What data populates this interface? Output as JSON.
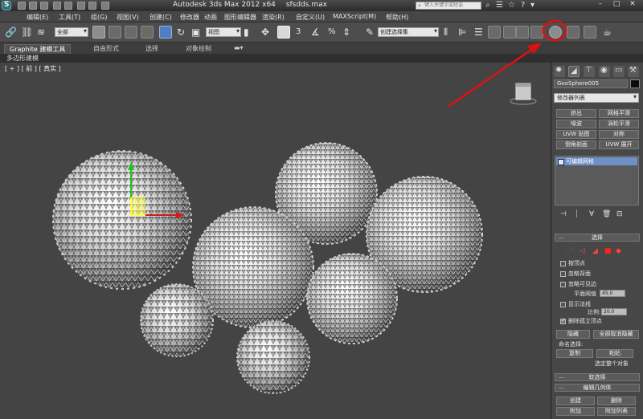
{
  "window": {
    "title_app": "Autodesk 3ds Max  2012 x64",
    "title_file": "sfsdds.max",
    "search_placeholder": "键入关键字或短语"
  },
  "menu": [
    "编辑(E)",
    "工具(T)",
    "组(G)",
    "视图(V)",
    "创建(C)",
    "修改器",
    "动画",
    "图形编辑器",
    "渲染(R)",
    "自定义(U)",
    "MAXScript(M)",
    "帮助(H)"
  ],
  "toolbar": {
    "filter_dropdown": "全部",
    "refcoord_dropdown": "视图",
    "named_selection": "创建选择集",
    "snap_label": "3",
    "angle_label": "%"
  },
  "ribbon": {
    "tabs": [
      "Graphite 建模工具",
      "自由形式",
      "选择",
      "对象绘制"
    ],
    "subtab": "多边形建模"
  },
  "viewport": {
    "label": "[ + ] [ 前 ] [ 真实 ]"
  },
  "command_panel": {
    "object_name": "GeoSphere005",
    "object_color": "#0a0a0a",
    "modifier_list": "修改器列表",
    "mod_buttons": [
      "挤出",
      "网格平滑",
      "噪波",
      "涡轮平滑",
      "UVW 贴图",
      "对称",
      "倒角剖面",
      "UVW 展开"
    ],
    "stack_item": "可编辑网格",
    "rollout_selection": "选择",
    "checkboxes": [
      {
        "label": "按顶点",
        "checked": false
      },
      {
        "label": "忽略背面",
        "checked": false
      },
      {
        "label": "忽略可见边",
        "checked": false
      },
      {
        "label": "显示法线",
        "checked": false
      },
      {
        "label": "删除孤立顶点",
        "checked": true
      }
    ],
    "planar_threshold_label": "平面阈值",
    "planar_threshold_value": "45.0",
    "scale_label": "比例:",
    "scale_value": "20.0",
    "hide_btn": "隐藏",
    "unhide_all_btn": "全部取消隐藏",
    "named_sel_label": "命名选择:",
    "copy_btn": "复制",
    "paste_btn": "粘贴",
    "select_whole": "选定整个对象",
    "rollout_soft": "软选择",
    "rollout_edit_geom": "编辑几何体",
    "create_btn": "创建",
    "delete_btn": "删除",
    "attach_btn": "附加",
    "attach_list_btn": "附加列表"
  },
  "annotation": {
    "color": "#e01010"
  }
}
